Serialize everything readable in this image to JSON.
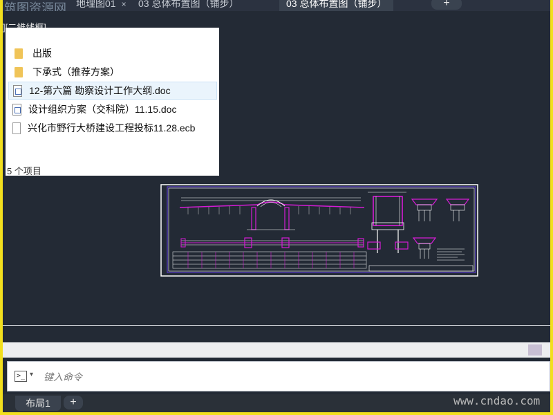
{
  "tabs": {
    "watermark_left": "筑图资源网",
    "tab1": "地理图01",
    "tab2": "03 总体布置图（铺步）",
    "tab3": "03 总体布置图（铺步）",
    "close_glyph": "×",
    "add_glyph": "+"
  },
  "viewport": {
    "label": "][二維线框]"
  },
  "explorer": {
    "items": [
      {
        "name": "出版",
        "type": "folder"
      },
      {
        "name": "下承式（推荐方案）",
        "type": "folder"
      },
      {
        "name": "12-第六篇 勘察设计工作大纲.doc",
        "type": "doc",
        "selected": true
      },
      {
        "name": "设计组织方案（交科院）11.15.doc",
        "type": "doc"
      },
      {
        "name": "兴化市野行大桥建设工程投标11.28.ecb",
        "type": "file"
      }
    ],
    "count_text": "5 个项目"
  },
  "command": {
    "placeholder": "键入命令",
    "arrow": "▾",
    "icon_text": ">_"
  },
  "layout": {
    "tab_label": "布局1",
    "add_glyph": "+"
  },
  "watermark_right": "www.cndao.com",
  "colors": {
    "background": "#232a35",
    "frame": "#f2df1e",
    "drawing_magenta": "#d51cd5",
    "drawing_white": "#ffffff"
  }
}
